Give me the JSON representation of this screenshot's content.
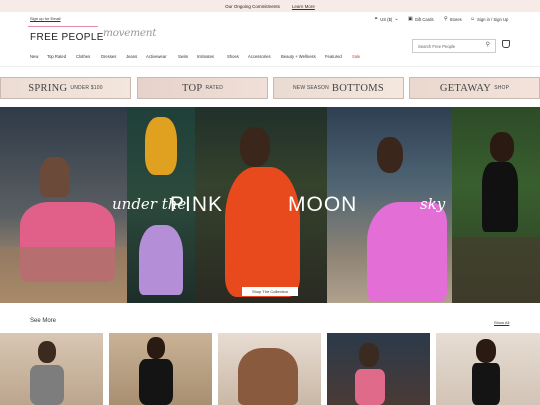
{
  "topbar": {
    "text": "Our Ongoing Commitments",
    "link": "Learn More"
  },
  "header": {
    "signup": "Sign up for Email",
    "logo": "FREE PEOPLE",
    "sub_brand": "movement",
    "utilities": [
      {
        "icon": "globe-icon",
        "label": "US ($)"
      },
      {
        "icon": "gift-icon",
        "label": "Gift Cards"
      },
      {
        "icon": "location-pin-icon",
        "label": "Stores"
      },
      {
        "icon": "user-icon",
        "label": "Sign in / Sign Up"
      }
    ],
    "search_placeholder": "Search Free People"
  },
  "nav": {
    "items": [
      "New",
      "Top Rated",
      "Clothes",
      "Dresses",
      "Jeans",
      "Activewear",
      "Swim",
      "Intimates",
      "Shoes",
      "Accessories",
      "Beauty + Wellness",
      "Featured",
      "Sale"
    ]
  },
  "promos": [
    {
      "big": "SPRING",
      "small": "UNDER $100"
    },
    {
      "big": "TOP",
      "small": "RATED"
    },
    {
      "big": "BOTTOMS",
      "small": "NEW SEASON"
    },
    {
      "big": "GETAWAY",
      "small": "SHOP"
    }
  ],
  "hero": {
    "script1": "under the",
    "word1": "PINK",
    "word2": "MOON",
    "script2": "sky",
    "cta": "Shop The Collection"
  },
  "more": {
    "title": "See More",
    "show_all": "Show All"
  },
  "colors": {
    "topbar": "#f6ebe6",
    "accent_pink": "#e88aa3",
    "sale": "#cc4444"
  }
}
